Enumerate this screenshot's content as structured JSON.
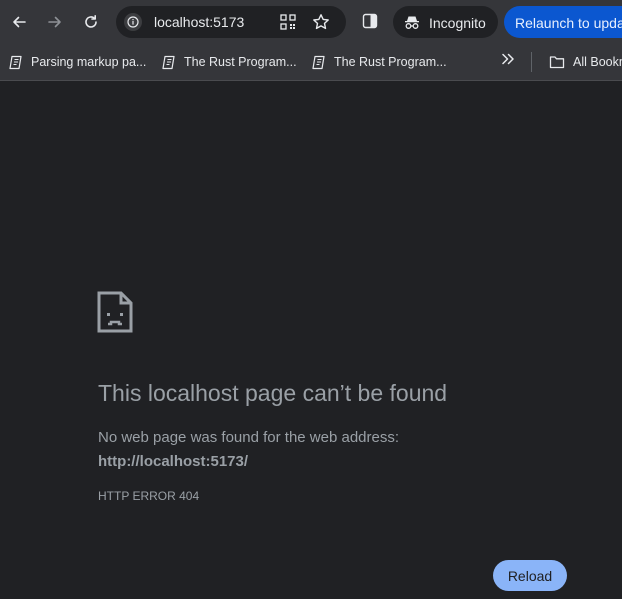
{
  "toolbar": {
    "back_icon": "arrow-left-icon",
    "forward_icon": "arrow-right-icon",
    "reload_icon": "reload-icon",
    "url": "localhost:5173",
    "incognito_label": "Incognito",
    "relaunch_label": "Relaunch to update"
  },
  "bookmarks": {
    "items": [
      {
        "label": "Parsing markup pa..."
      },
      {
        "label": "The Rust Program..."
      },
      {
        "label": "The Rust Program..."
      }
    ],
    "all_bookmarks_label": "All Bookmarks"
  },
  "error": {
    "title": "This localhost page can’t be found",
    "description": "No web page was found for the web address:",
    "url": "http://localhost:5173/",
    "code": "HTTP ERROR 404",
    "reload_label": "Reload"
  },
  "colors": {
    "page_bg": "#202124",
    "toolbar_bg": "#35363a",
    "accent": "#8ab4f8",
    "relaunch_bg": "#0b57d0",
    "text_muted": "#9aa0a6"
  }
}
